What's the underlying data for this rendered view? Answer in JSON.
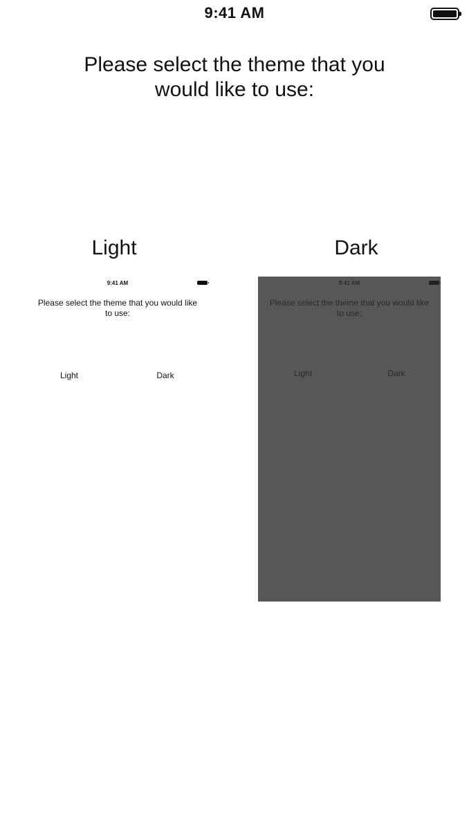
{
  "status_bar": {
    "time": "9:41 AM",
    "battery_icon": "battery-full-icon"
  },
  "prompt": "Please select the theme that you would like to use:",
  "options": {
    "light": {
      "label": "Light",
      "preview": {
        "time": "9:41 AM",
        "prompt": "Please select the theme that you would like to use:",
        "light_label": "Light",
        "dark_label": "Dark",
        "background": "#ffffff"
      }
    },
    "dark": {
      "label": "Dark",
      "preview": {
        "time": "9:41 AM",
        "prompt": "Please select the theme that you would like to use:",
        "light_label": "Light",
        "dark_label": "Dark",
        "background": "#575757"
      }
    }
  }
}
